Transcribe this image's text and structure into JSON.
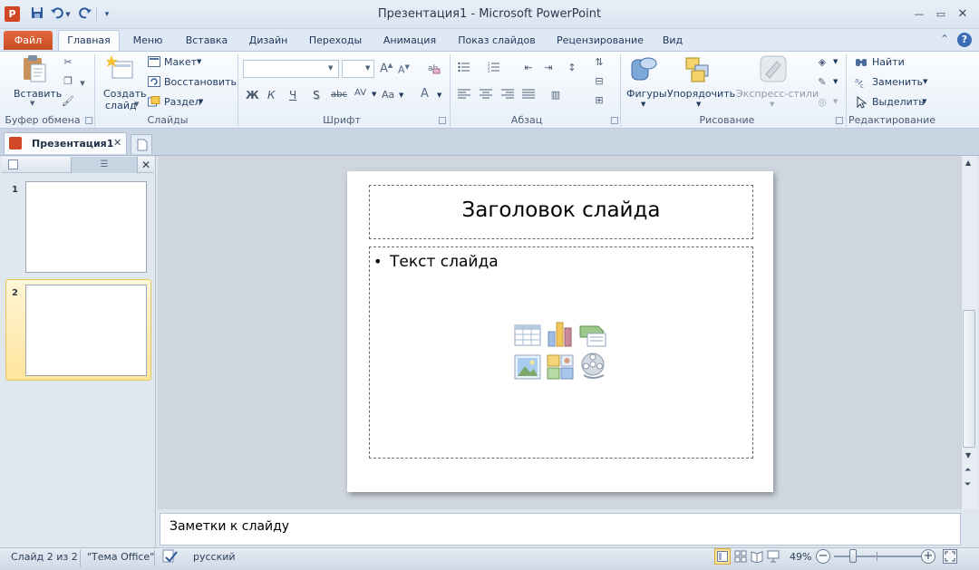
{
  "window": {
    "title": "Презентация1  -  Microsoft PowerPoint",
    "app_icon": "P"
  },
  "quick_access": {
    "icons": [
      "save-icon",
      "undo-icon",
      "redo-icon",
      "customize-icon"
    ]
  },
  "ribbon_tabs": {
    "file": "Файл",
    "items": [
      "Главная",
      "Меню",
      "Вставка",
      "Дизайн",
      "Переходы",
      "Анимация",
      "Показ слайдов",
      "Рецензирование",
      "Вид"
    ],
    "active": "Главная"
  },
  "groups": {
    "clipboard": {
      "label": "Буфер обмена",
      "paste": "Вставить"
    },
    "slides": {
      "label": "Слайды",
      "new_slide_line1": "Создать",
      "new_slide_line2": "слайд",
      "layout": "Макет",
      "reset": "Восстановить",
      "section": "Раздел"
    },
    "font": {
      "label": "Шрифт",
      "bold": "Ж",
      "italic": "К",
      "underline": "Ч",
      "shadow": "S",
      "strike": "abc",
      "spacing": "AV",
      "case": "Aa",
      "color": "A"
    },
    "paragraph": {
      "label": "Абзац"
    },
    "drawing": {
      "label": "Рисование",
      "shapes": "Фигуры",
      "arrange": "Упорядочить",
      "quick_styles": "Экспресс-стили"
    },
    "editing": {
      "label": "Редактирование",
      "find": "Найти",
      "replace": "Заменить",
      "select": "Выделить"
    }
  },
  "document_tab": {
    "name": "Презентация1"
  },
  "slides": [
    {
      "number": "1"
    },
    {
      "number": "2"
    }
  ],
  "slide": {
    "title": "Заголовок слайда",
    "bullet": "•",
    "body_text": "Текст слайда"
  },
  "notes": {
    "text": "Заметки к слайду"
  },
  "status_bar": {
    "slide_info": "Слайд 2 из 2",
    "theme": "\"Тема Office\"",
    "language": "русский",
    "zoom": "49%",
    "zoom_level_percent": 49
  },
  "colors": {
    "file_tab": "#d24726",
    "accent": "#2a4f86",
    "selected_thumb": "#ffe59c"
  }
}
